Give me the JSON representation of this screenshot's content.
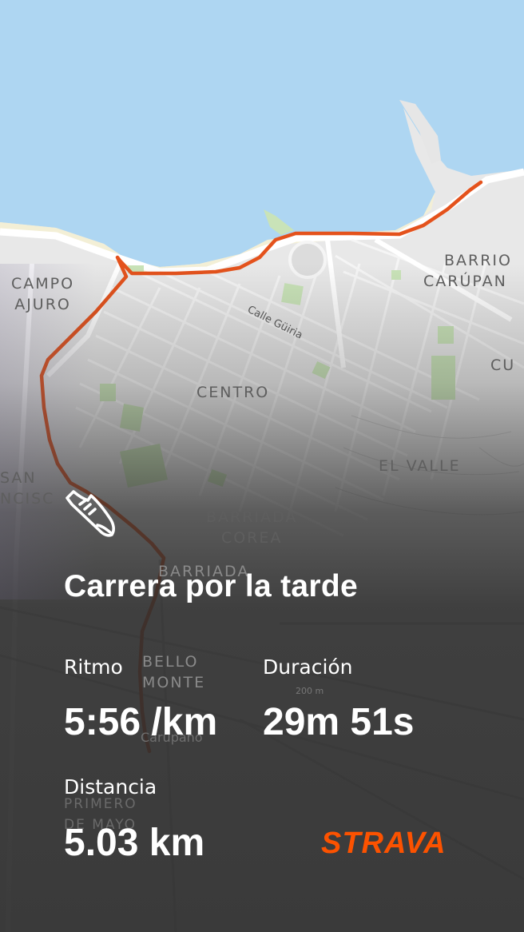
{
  "activity": {
    "title": "Carrera por la tarde",
    "icon": "running-shoe-icon"
  },
  "stats": {
    "pace_label": "Ritmo",
    "pace_value": "5:56 /km",
    "duration_label": "Duración",
    "duration_value": "29m 51s",
    "distance_label": "Distancia",
    "distance_value": "5.03 km"
  },
  "brand": {
    "name": "STRAVA",
    "color": "#fc5200"
  },
  "map": {
    "route_color": "#e4521c",
    "water_color": "#aed6f2",
    "labels": {
      "campo_ajuro": [
        "CAMPO",
        "AJURO"
      ],
      "centro": "CENTRO",
      "barrio_carupano": [
        "BARRIO",
        "CARÚPAN"
      ],
      "el_valle": "EL VALLE",
      "cu": "CU",
      "san_francisco": [
        "SAN",
        "NCISC"
      ],
      "barriada_corea": [
        "BARRIADA",
        "COREA"
      ],
      "barriada": "BARRIADA",
      "bello_monte": [
        "BELLO",
        "MONTE"
      ],
      "primero_de_mayo": [
        "PRIMERO",
        "DE MAYO"
      ],
      "carupano": "Carúpano",
      "calle_guiria": "Calle Güiria",
      "elevation": "200 m"
    }
  }
}
